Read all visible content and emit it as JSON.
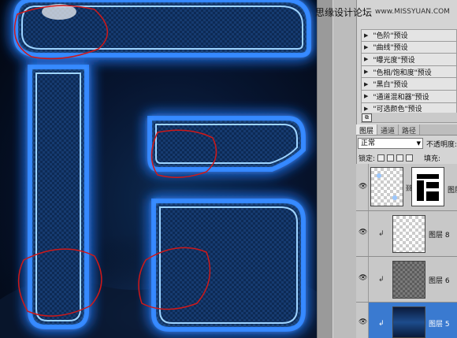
{
  "watermark": {
    "text": "思缘设计论坛",
    "url": "www.MISSYUAN.COM"
  },
  "presets": {
    "items": [
      {
        "label": "\"色阶\"预设"
      },
      {
        "label": "\"曲线\"预设"
      },
      {
        "label": "\"曝光度\"预设"
      },
      {
        "label": "\"色相/饱和度\"预设"
      },
      {
        "label": "\"黑白\"预设"
      },
      {
        "label": "\"通道混和器\"预设"
      },
      {
        "label": "\"可选颜色\"预设"
      }
    ]
  },
  "layers_panel": {
    "tabs": [
      {
        "label": "图层"
      },
      {
        "label": "通道"
      },
      {
        "label": "路径"
      }
    ],
    "blend_mode": "正常",
    "opacity_label": "不透明度:",
    "lock_label": "锁定:",
    "fill_label": "填充:",
    "layers": [
      {
        "name": "图层"
      },
      {
        "name": "图层 8"
      },
      {
        "name": "图层 6"
      },
      {
        "name": "图层 5"
      }
    ]
  },
  "colors": {
    "neon_blue": "#2a7bff",
    "neon_core": "#9fd4ff",
    "annotation_red": "#d01818",
    "selection_blue": "#3a7ad0"
  }
}
